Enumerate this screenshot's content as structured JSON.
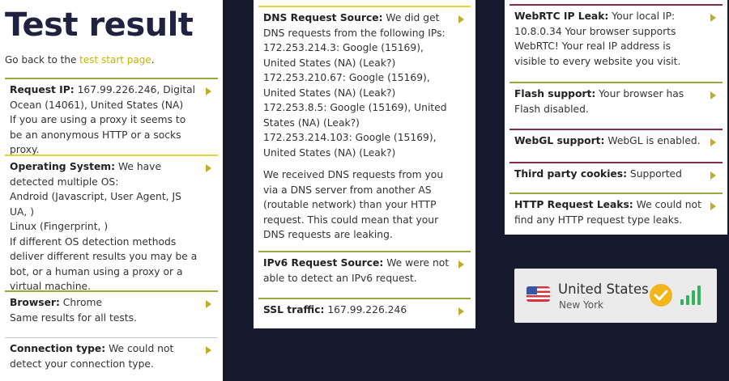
{
  "left": {
    "title": "Test result",
    "goback_prefix": "Go back to the ",
    "goback_link": "test start page",
    "goback_suffix": ".",
    "request_ip": {
      "label": "Request IP:",
      "text": " 167.99.226.246, Digital Ocean (14061), United States (NA)",
      "note": "If you are using a proxy it seems to be an anonymous HTTP or a socks proxy."
    },
    "os": {
      "label": "Operating System:",
      "text": " We have detected multiple OS:",
      "line1": "Android (Javascript, User Agent, JS UA, )",
      "line2": "Linux (Fingerprint, )",
      "note": "If different OS detection methods deliver different results you may be a bot, or a human using a proxy or a virtual machine."
    },
    "browser": {
      "label": "Browser:",
      "text": " Chrome",
      "note": "Same results for all tests."
    },
    "connection": {
      "label": "Connection type:",
      "text": " We could not detect your connection type."
    }
  },
  "mid": {
    "dns": {
      "label": "DNS Request Source:",
      "text": " We did get DNS requests from the following IPs:",
      "ips": [
        "172.253.214.3: Google (15169), United States (NA) (Leak?)",
        "172.253.210.67: Google (15169), United States (NA) (Leak?)",
        "172.253.8.5: Google (15169), United States (NA) (Leak?)",
        "172.253.214.103: Google (15169), United States (NA) (Leak?)"
      ],
      "note": "We received DNS requests from you via a DNS server from another AS (routable network) than your HTTP request. This could mean that your DNS requests are leaking."
    },
    "ipv6": {
      "label": "IPv6 Request Source:",
      "text": " We were not able to detect an IPv6 request."
    },
    "ssl": {
      "label": "SSL traffic:",
      "text": " 167.99.226.246"
    }
  },
  "right": {
    "webrtc": {
      "label": "WebRTC IP Leak:",
      "text": " Your local IP: 10.8.0.34 Your browser supports WebRTC! Your real IP address is visible to every website you visit."
    },
    "flash": {
      "label": "Flash support:",
      "text": " Your browser has Flash disabled."
    },
    "webgl": {
      "label": "WebGL support:",
      "text": " WebGL is enabled."
    },
    "cookies": {
      "label": "Third party cookies:",
      "text": " Supported"
    },
    "http_leaks": {
      "label": "HTTP Request Leaks:",
      "text": " We could not find any HTTP request type leaks."
    }
  },
  "vpn": {
    "country": "United States",
    "city": "New York",
    "flag_icon": "us-flag-icon",
    "check_icon": "checkmark-icon",
    "signal_icon": "signal-bars-icon",
    "signal_level": "4/4",
    "check_color": "#f2b51b",
    "signal_color": "#35b35c"
  }
}
